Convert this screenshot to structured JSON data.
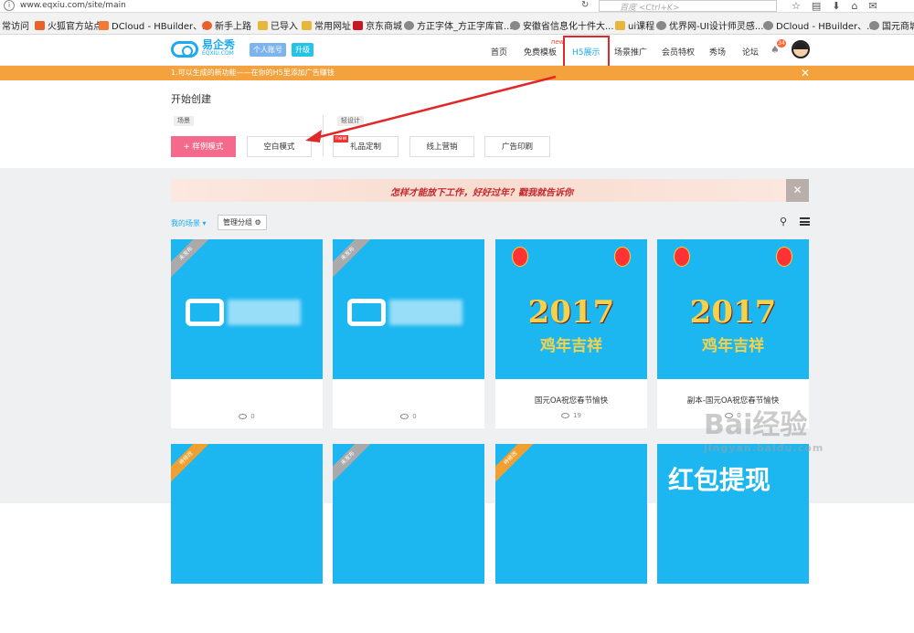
{
  "browser": {
    "url": "www.eqxiu.com/site/main",
    "search_placeholder": "百度 <Ctrl+K>",
    "bookmarks": [
      {
        "label": "常访问",
        "color": "#f2f2f2"
      },
      {
        "label": "火狐官方站点",
        "color": "#e8622d"
      },
      {
        "label": "DCloud - HBuilder、...",
        "color": "#f07a36"
      },
      {
        "label": "新手上路",
        "color": "#e8622d"
      },
      {
        "label": "已导入",
        "color": "#e7b73c"
      },
      {
        "label": "常用网址",
        "color": "#e7b73c"
      },
      {
        "label": "京东商城",
        "color": "#c91623"
      },
      {
        "label": "方正字体_方正字库官...",
        "color": "#888888"
      },
      {
        "label": "安徽省信息化十件大...",
        "color": "#888888"
      },
      {
        "label": "ui课程",
        "color": "#e7b73c"
      },
      {
        "label": "优界网-UI设计师灵感...",
        "color": "#888888"
      },
      {
        "label": "DCloud - HBuilder、...",
        "color": "#888888"
      },
      {
        "label": "国元商城",
        "color": "#888888"
      }
    ]
  },
  "header": {
    "logo_cn": "易企秀",
    "logo_en": "EQXIU.COM",
    "personal_account": "个人账号",
    "upgrade": "升级",
    "nav": [
      "首页",
      "免费模板",
      "H5展示",
      "场景推广",
      "会员特权",
      "秀场",
      "论坛"
    ],
    "new_tag": "new",
    "badge_count": "34"
  },
  "notice": {
    "text": "1.可以生成的新功能——在你的H5里添加广告赚钱"
  },
  "create": {
    "title": "开始创建",
    "tag_scene": "场景",
    "tag_design": "轻设计",
    "buttons": [
      "+ 样例模式",
      "空白模式",
      "礼品定制",
      "线上营销",
      "广告印刷"
    ],
    "new_label": "new"
  },
  "main": {
    "banner_text": "怎样才能放下工作，好好过年？戳我就告诉你",
    "my_scenes": "我的场景",
    "manage_groups": "管理分组",
    "cards": [
      {
        "status": "未发布",
        "title": "",
        "views": "0"
      },
      {
        "status": "未发布",
        "title": "",
        "views": "0"
      },
      {
        "status": "",
        "title": "国元OA祝您春节愉快",
        "views": "19",
        "cny_year": "2017",
        "cny_sub": "鸡年吉祥"
      },
      {
        "status": "",
        "title": "副本-国元OA祝您春节愉快",
        "views": "0",
        "cny_year": "2017",
        "cny_sub": "鸡年吉祥"
      },
      {
        "status": "待修改",
        "title": "",
        "views": ""
      },
      {
        "status": "未发布",
        "title": "",
        "views": ""
      },
      {
        "status": "待修改",
        "title": "",
        "views": ""
      },
      {
        "status": "",
        "title": "",
        "views": "",
        "red_text": "红包提现"
      }
    ]
  },
  "watermark": {
    "brand": "Bai经验",
    "url": "jingyan.baidu.com"
  }
}
